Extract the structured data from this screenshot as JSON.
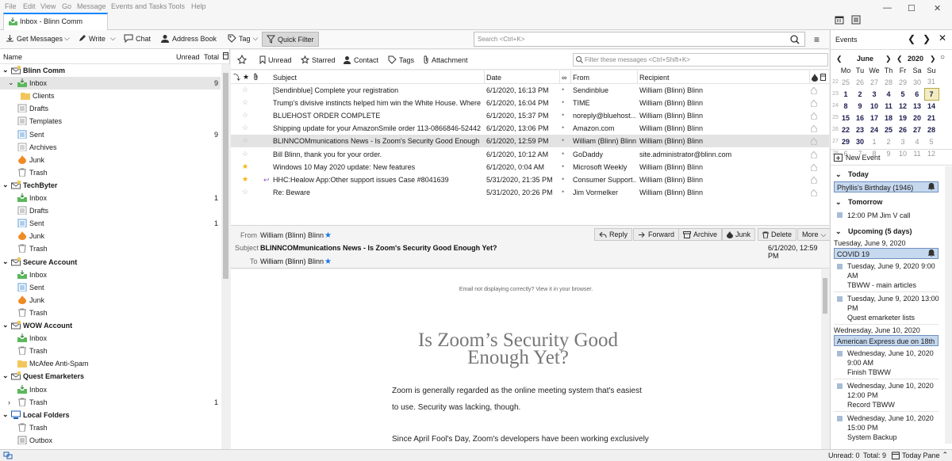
{
  "menu": [
    "File",
    "Edit",
    "View",
    "Go",
    "Message",
    "Events and Tasks",
    "Tools",
    "Help"
  ],
  "tab": {
    "title": "Inbox - Blinn Comm"
  },
  "toolbar": {
    "get_messages": "Get Messages",
    "write": "Write",
    "chat": "Chat",
    "address_book": "Address Book",
    "tag": "Tag",
    "quick_filter": "Quick Filter"
  },
  "search": {
    "placeholder": "Search <Ctrl+K>"
  },
  "folder_header": {
    "name": "Name",
    "unread": "Unread",
    "total": "Total"
  },
  "folders": [
    {
      "label": "Blinn Comm",
      "type": "account",
      "count": ""
    },
    {
      "label": "Inbox",
      "type": "inbox",
      "count": "9",
      "selected": true
    },
    {
      "label": "Clients",
      "type": "folder",
      "count": ""
    },
    {
      "label": "Drafts",
      "type": "drafts",
      "count": ""
    },
    {
      "label": "Templates",
      "type": "drafts",
      "count": ""
    },
    {
      "label": "Sent",
      "type": "sent",
      "count": "9"
    },
    {
      "label": "Archives",
      "type": "archive",
      "count": ""
    },
    {
      "label": "Junk",
      "type": "junk",
      "count": ""
    },
    {
      "label": "Trash",
      "type": "trash",
      "count": ""
    },
    {
      "label": "TechByter",
      "type": "account",
      "count": ""
    },
    {
      "label": "Inbox",
      "type": "inbox",
      "count": "1"
    },
    {
      "label": "Drafts",
      "type": "drafts",
      "count": ""
    },
    {
      "label": "Sent",
      "type": "sent",
      "count": "1"
    },
    {
      "label": "Junk",
      "type": "junk",
      "count": ""
    },
    {
      "label": "Trash",
      "type": "trash",
      "count": ""
    },
    {
      "label": "Secure Account",
      "type": "account",
      "count": ""
    },
    {
      "label": "Inbox",
      "type": "inbox",
      "count": ""
    },
    {
      "label": "Sent",
      "type": "sent",
      "count": ""
    },
    {
      "label": "Junk",
      "type": "junk",
      "count": ""
    },
    {
      "label": "Trash",
      "type": "trash",
      "count": ""
    },
    {
      "label": "WOW Account",
      "type": "account",
      "count": ""
    },
    {
      "label": "Inbox",
      "type": "inbox",
      "count": ""
    },
    {
      "label": "Trash",
      "type": "trash",
      "count": ""
    },
    {
      "label": "McAfee Anti-Spam",
      "type": "folder",
      "count": ""
    },
    {
      "label": "Quest Emarketers",
      "type": "account",
      "count": ""
    },
    {
      "label": "Inbox",
      "type": "inbox",
      "count": ""
    },
    {
      "label": "Trash",
      "type": "trash",
      "count": "1"
    },
    {
      "label": "Local Folders",
      "type": "local",
      "count": ""
    },
    {
      "label": "Trash",
      "type": "trash",
      "count": ""
    },
    {
      "label": "Outbox",
      "type": "outbox",
      "count": ""
    }
  ],
  "quick_filter": {
    "unread": "Unread",
    "starred": "Starred",
    "contact": "Contact",
    "tags": "Tags",
    "attachment": "Attachment",
    "placeholder": "Filter these messages <Ctrl+Shift+K>"
  },
  "thread_columns": {
    "subject": "Subject",
    "date": "Date",
    "from": "From",
    "recipient": "Recipient"
  },
  "messages": [
    {
      "subject": "[Sendinblue] Complete your registration",
      "date": "6/1/2020, 16:13 PM",
      "from": "Sendinblue",
      "recipient": "William (Blinn) Blinn",
      "starred": false
    },
    {
      "subject": "Trump's divisive instincts helped him win the White House. Where …",
      "date": "6/1/2020, 16:04 PM",
      "from": "TIME",
      "recipient": "William (Blinn) Blinn",
      "starred": false
    },
    {
      "subject": "BLUEHOST ORDER COMPLETE",
      "date": "6/1/2020, 15:37 PM",
      "from": "noreply@bluehost…",
      "recipient": "William (Blinn) Blinn",
      "starred": false
    },
    {
      "subject": "Shipping update for your AmazonSmile order 113-0866846-5244206",
      "date": "6/1/2020, 13:06 PM",
      "from": "Amazon.com",
      "recipient": "William (Blinn) Blinn",
      "starred": false
    },
    {
      "subject": "BLINNCOMmunications News - Is Zoom's Security Good Enough …",
      "date": "6/1/2020, 12:59 PM",
      "from": "William (Blinn) Blinn",
      "recipient": "William (Blinn) Blinn",
      "starred": false,
      "selected": true
    },
    {
      "subject": "Bill Blinn, thank you for your order.",
      "date": "6/1/2020, 10:12 AM",
      "from": "GoDaddy",
      "recipient": "site.administrator@blinn.com",
      "starred": false
    },
    {
      "subject": "Windows 10 May 2020 update: New features",
      "date": "6/1/2020, 0:04 AM",
      "from": "Microsoft Weekly",
      "recipient": "William (Blinn) Blinn",
      "starred": true
    },
    {
      "subject": "HHC:Healow App:Other support issues Case #8041639",
      "date": "5/31/2020, 21:35 PM",
      "from": "Consumer Support…",
      "recipient": "William (Blinn) Blinn",
      "starred": true,
      "replied": true
    },
    {
      "subject": "Re: Beware",
      "date": "5/31/2020, 20:26 PM",
      "from": "Jim Vormelker",
      "recipient": "William (Blinn) Blinn",
      "starred": false
    }
  ],
  "message_header": {
    "from_label": "From",
    "from": "William (Blinn) Blinn",
    "subject_label": "Subject",
    "subject": "BLINNCOMmunications News - Is Zoom's Security Good Enough Yet?",
    "to_label": "To",
    "to": "William (Blinn) Blinn",
    "date": "6/1/2020, 12:59 PM",
    "buttons": {
      "reply": "Reply",
      "forward": "Forward",
      "archive": "Archive",
      "junk": "Junk",
      "delete": "Delete",
      "more": "More"
    }
  },
  "message_body": {
    "notice": "Email not displaying correctly? View it in your browser.",
    "headline_1": "Is Zoom’s Security Good",
    "headline_2": "Enough Yet?",
    "para_1a": "Zoom is generally regarded as the online meeting system that's easiest",
    "para_1b": "to use. Security was lacking, though.",
    "para_2": "Since April Fool's Day, Zoom's developers have been working exclusively"
  },
  "today_pane": {
    "title": "Events",
    "month": "June",
    "year": "2020",
    "weekdays": [
      "Mo",
      "Tu",
      "We",
      "Th",
      "Fr",
      "Sa",
      "Su"
    ],
    "weeks": [
      [
        "25",
        "26",
        "27",
        "28",
        "29",
        "30",
        "31"
      ],
      [
        "1",
        "2",
        "3",
        "4",
        "5",
        "6",
        "7"
      ],
      [
        "8",
        "9",
        "10",
        "11",
        "12",
        "13",
        "14"
      ],
      [
        "15",
        "16",
        "17",
        "18",
        "19",
        "20",
        "21"
      ],
      [
        "22",
        "23",
        "24",
        "25",
        "26",
        "27",
        "28"
      ],
      [
        "29",
        "30",
        "1",
        "2",
        "3",
        "4",
        "5"
      ],
      [
        "6",
        "7",
        "8",
        "9",
        "10",
        "11",
        "12"
      ]
    ],
    "week_numbers": [
      "22",
      "23",
      "24",
      "25",
      "26",
      "27",
      "28"
    ],
    "new_event": "New Event",
    "today_label": "Today",
    "today_event": "Phyllis's Birthday (1946)",
    "tomorrow_label": "Tomorrow",
    "tomorrow_event": "12:00 PM Jim V call",
    "upcoming_label": "Upcoming (5 days)",
    "day1": "Tuesday, June 9, 2020",
    "day1_allday": "COVID 19",
    "ev1_time_a": "Tuesday, June 9, 2020 9:00",
    "ev1_time_b": "AM",
    "ev1_title": "TBWW - main articles",
    "ev2_time_a": "Tuesday, June 9, 2020 13:00",
    "ev2_time_b": "PM",
    "ev2_title": "Quest emarketer lists",
    "day2": "Wednesday, June 10, 2020",
    "day2_allday": "American Express due on 18th",
    "ev3_time_a": "Wednesday, June 10, 2020",
    "ev3_time_b": "9:00 AM",
    "ev3_title": "Finish TBWW",
    "ev4_time_a": "Wednesday, June 10, 2020",
    "ev4_time_b": "12:00 PM",
    "ev4_title": "Record TBWW",
    "ev5_time_a": "Wednesday, June 10, 2020",
    "ev5_time_b": "15:00 PM",
    "ev5_title": "System Backup"
  },
  "status": {
    "unread": "Unread: 0",
    "total": "Total: 9",
    "today_pane": "Today Pane"
  },
  "colors": {
    "accent": "#0a84ff",
    "selected_row": "#e3e3e3",
    "star_on": "#f4b400",
    "allday_event": "#c6d8ee"
  }
}
